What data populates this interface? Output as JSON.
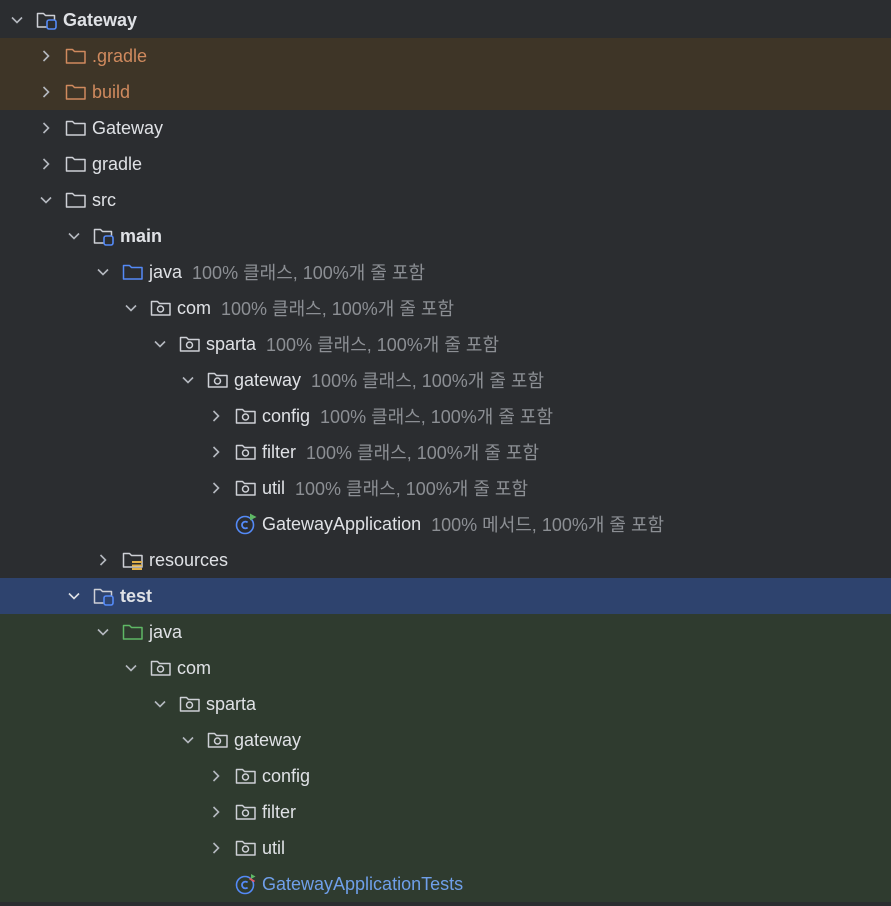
{
  "project_tree": {
    "rows": [
      {
        "label": "Gateway",
        "coverage": ""
      },
      {
        "label": ".gradle",
        "coverage": ""
      },
      {
        "label": "build",
        "coverage": ""
      },
      {
        "label": "Gateway",
        "coverage": ""
      },
      {
        "label": "gradle",
        "coverage": ""
      },
      {
        "label": "src",
        "coverage": ""
      },
      {
        "label": "main",
        "coverage": ""
      },
      {
        "label": "java",
        "coverage": "100% 클래스, 100%개 줄 포함"
      },
      {
        "label": "com",
        "coverage": "100% 클래스, 100%개 줄 포함"
      },
      {
        "label": "sparta",
        "coverage": "100% 클래스, 100%개 줄 포함"
      },
      {
        "label": "gateway",
        "coverage": "100% 클래스, 100%개 줄 포함"
      },
      {
        "label": "config",
        "coverage": "100% 클래스, 100%개 줄 포함"
      },
      {
        "label": "filter",
        "coverage": "100% 클래스, 100%개 줄 포함"
      },
      {
        "label": "util",
        "coverage": "100% 클래스, 100%개 줄 포함"
      },
      {
        "label": "GatewayApplication",
        "coverage": "100% 메서드, 100%개 줄 포함"
      },
      {
        "label": "resources",
        "coverage": ""
      },
      {
        "label": "test",
        "coverage": ""
      },
      {
        "label": "java",
        "coverage": ""
      },
      {
        "label": "com",
        "coverage": ""
      },
      {
        "label": "sparta",
        "coverage": ""
      },
      {
        "label": "gateway",
        "coverage": ""
      },
      {
        "label": "config",
        "coverage": ""
      },
      {
        "label": "filter",
        "coverage": ""
      },
      {
        "label": "util",
        "coverage": ""
      },
      {
        "label": "GatewayApplicationTests",
        "coverage": ""
      }
    ]
  },
  "icons": {
    "module": "module-folder-icon",
    "folder": "folder-icon",
    "source_root": "source-root-folder-icon",
    "test_root": "test-root-folder-icon",
    "package": "package-folder-icon",
    "resources": "resources-folder-icon",
    "app_class": "spring-boot-application-class-icon",
    "test_class": "test-class-icon"
  },
  "colors": {
    "background": "#2b2d30",
    "excluded_row": "#3e3527",
    "selected_row": "#2e436e",
    "test_zone": "#2f3b2f",
    "excluded_text": "#d08a5e",
    "coverage_text": "#8c8f94",
    "test_class_text": "#6f9fe9"
  }
}
